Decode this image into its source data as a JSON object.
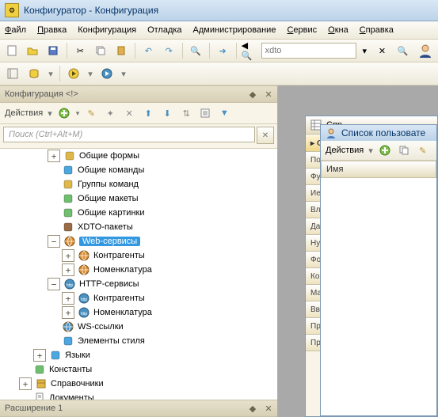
{
  "title_app": "Конфигуратор",
  "title_doc": "Конфигурация",
  "menu": [
    "Файл",
    "Правка",
    "Конфигурация",
    "Отладка",
    "Администрирование",
    "Сервис",
    "Окна",
    "Справка"
  ],
  "toolbar_search": "xdto",
  "panel_title": "Конфигурация <!>",
  "actions_label": "Действия",
  "search_placeholder": "Поиск (Ctrl+Alt+M)",
  "nodes": [
    {
      "d": 1,
      "tw": "+",
      "ic": "form",
      "label": "Общие формы"
    },
    {
      "d": 1,
      "tw": "",
      "ic": "cmd",
      "label": "Общие команды"
    },
    {
      "d": 1,
      "tw": "",
      "ic": "grp",
      "label": "Группы команд"
    },
    {
      "d": 1,
      "tw": "",
      "ic": "tmpl",
      "label": "Общие макеты"
    },
    {
      "d": 1,
      "tw": "",
      "ic": "pic",
      "label": "Общие картинки"
    },
    {
      "d": 1,
      "tw": "",
      "ic": "xdto",
      "label": "XDTO-пакеты"
    },
    {
      "d": 1,
      "tw": "-",
      "ic": "web",
      "label": "Web-сервисы",
      "sel": true
    },
    {
      "d": 2,
      "tw": "+",
      "ic": "web",
      "label": "Контрагенты"
    },
    {
      "d": 2,
      "tw": "+",
      "ic": "web",
      "label": "Номенклатура"
    },
    {
      "d": 1,
      "tw": "-",
      "ic": "http",
      "label": "HTTP-сервисы"
    },
    {
      "d": 2,
      "tw": "+",
      "ic": "http",
      "label": "Контрагенты"
    },
    {
      "d": 2,
      "tw": "+",
      "ic": "http",
      "label": "Номенклатура"
    },
    {
      "d": 1,
      "tw": "",
      "ic": "ws",
      "label": "WS-ссылки"
    },
    {
      "d": 1,
      "tw": "",
      "ic": "style",
      "label": "Элементы стиля"
    },
    {
      "d": 0,
      "tw": "+",
      "ic": "lang",
      "label": "Языки"
    },
    {
      "d": -1,
      "tw": "",
      "ic": "const",
      "label": "Константы"
    },
    {
      "d": -1,
      "tw": "+",
      "ic": "ref",
      "label": "Справочники"
    },
    {
      "d": -1,
      "tw": "",
      "ic": "doc",
      "label": "Документы"
    }
  ],
  "ext_title": "Расширение 1",
  "right_hdr": "Спр",
  "right_sub_title": "Список пользовате",
  "right_actions": "Действия",
  "right_col": "Имя",
  "vtabs": [
    "Ос",
    "По",
    "Фу",
    "Ие",
    "Вл",
    "Да",
    "Ну",
    "Фо",
    "Ко",
    "Ма",
    "Вв",
    "Пр",
    "Пр"
  ],
  "icon_colors": {
    "form": "#e0b84a",
    "cmd": "#4aa7e0",
    "grp": "#e0b84a",
    "tmpl": "#6ec06e",
    "pic": "#6ec06e",
    "xdto": "#9a6b44",
    "web": "#d88b2e",
    "http": "#4a90c0",
    "ws": "#4a90c0",
    "style": "#4aa7e0",
    "lang": "#4aa7e0",
    "const": "#6ec06e",
    "ref": "#e0b84a",
    "doc": "#d6d0b4"
  }
}
